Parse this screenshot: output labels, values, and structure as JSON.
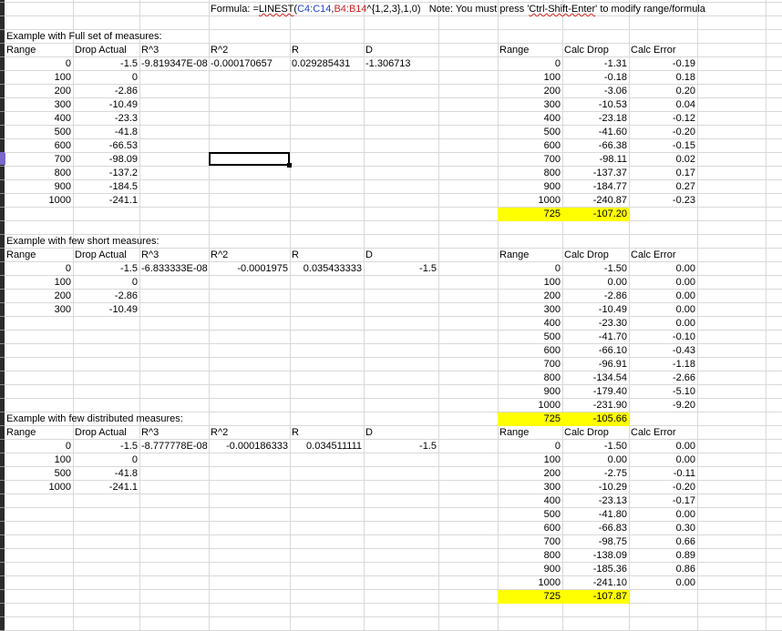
{
  "formula": {
    "prefix": "Formula: =",
    "func": "LINEST",
    "open": "(",
    "ref1": "C4:C14",
    "comma": ",",
    "ref2": "B4:B14",
    "suffix": "^{1,2,3},1,0)",
    "note_a": "Note: You must press '",
    "note_key": "Ctrl-Shift-Enter",
    "note_b": "' to modify range/formula"
  },
  "colors": {
    "highlight": "#ffff00",
    "ref1": "#1f3fd0",
    "ref2": "#d01f1f",
    "grid": "#d9d9d9"
  },
  "sections": [
    {
      "title": "Example with Full set of measures:",
      "input_headers": [
        "Range",
        "Drop Actual",
        "R^3",
        "R^2",
        "R",
        "D"
      ],
      "coeffs": [
        "-9.819347E-08",
        "-0.000170657",
        "0.029285431",
        "-1.306713"
      ],
      "input_rows": [
        [
          "0",
          "-1.5"
        ],
        [
          "100",
          "0"
        ],
        [
          "200",
          "-2.86"
        ],
        [
          "300",
          "-10.49"
        ],
        [
          "400",
          "-23.3"
        ],
        [
          "500",
          "-41.8"
        ],
        [
          "600",
          "-66.53"
        ],
        [
          "700",
          "-98.09"
        ],
        [
          "800",
          "-137.2"
        ],
        [
          "900",
          "-184.5"
        ],
        [
          "1000",
          "-241.1"
        ]
      ],
      "calc_headers": [
        "Range",
        "Calc Drop",
        "Calc Error"
      ],
      "calc_rows": [
        [
          "0",
          "-1.31",
          "-0.19"
        ],
        [
          "100",
          "-0.18",
          "0.18"
        ],
        [
          "200",
          "-3.06",
          "0.20"
        ],
        [
          "300",
          "-10.53",
          "0.04"
        ],
        [
          "400",
          "-23.18",
          "-0.12"
        ],
        [
          "500",
          "-41.60",
          "-0.20"
        ],
        [
          "600",
          "-66.38",
          "-0.15"
        ],
        [
          "700",
          "-98.11",
          "0.02"
        ],
        [
          "800",
          "-137.37",
          "0.17"
        ],
        [
          "900",
          "-184.77",
          "0.27"
        ],
        [
          "1000",
          "-240.87",
          "-0.23"
        ]
      ],
      "highlight_row": [
        "725",
        "-107.20"
      ]
    },
    {
      "title": "Example with few short measures:",
      "input_headers": [
        "Range",
        "Drop Actual",
        "R^3",
        "R^2",
        "R",
        "D"
      ],
      "coeffs": [
        "-6.833333E-08",
        "-0.0001975",
        "0.035433333",
        "-1.5"
      ],
      "input_rows": [
        [
          "0",
          "-1.5"
        ],
        [
          "100",
          "0"
        ],
        [
          "200",
          "-2.86"
        ],
        [
          "300",
          "-10.49"
        ]
      ],
      "calc_headers": [
        "Range",
        "Calc Drop",
        "Calc Error"
      ],
      "calc_rows": [
        [
          "0",
          "-1.50",
          "0.00"
        ],
        [
          "100",
          "0.00",
          "0.00"
        ],
        [
          "200",
          "-2.86",
          "0.00"
        ],
        [
          "300",
          "-10.49",
          "0.00"
        ],
        [
          "400",
          "-23.30",
          "0.00"
        ],
        [
          "500",
          "-41.70",
          "-0.10"
        ],
        [
          "600",
          "-66.10",
          "-0.43"
        ],
        [
          "700",
          "-96.91",
          "-1.18"
        ],
        [
          "800",
          "-134.54",
          "-2.66"
        ],
        [
          "900",
          "-179.40",
          "-5.10"
        ],
        [
          "1000",
          "-231.90",
          "-9.20"
        ]
      ],
      "highlight_row": [
        "725",
        "-105.66"
      ]
    },
    {
      "title": "Example with few distributed measures:",
      "input_headers": [
        "Range",
        "Drop Actual",
        "R^3",
        "R^2",
        "R",
        "D"
      ],
      "coeffs": [
        "-8.777778E-08",
        "-0.000186333",
        "0.034511111",
        "-1.5"
      ],
      "input_rows": [
        [
          "0",
          "-1.5"
        ],
        [
          "100",
          "0"
        ],
        [
          "500",
          "-41.8"
        ],
        [
          "1000",
          "-241.1"
        ]
      ],
      "calc_headers": [
        "Range",
        "Calc Drop",
        "Calc Error"
      ],
      "calc_rows": [
        [
          "0",
          "-1.50",
          "0.00"
        ],
        [
          "100",
          "0.00",
          "0.00"
        ],
        [
          "200",
          "-2.75",
          "-0.11"
        ],
        [
          "300",
          "-10.29",
          "-0.20"
        ],
        [
          "400",
          "-23.13",
          "-0.17"
        ],
        [
          "500",
          "-41.80",
          "0.00"
        ],
        [
          "600",
          "-66.83",
          "0.30"
        ],
        [
          "700",
          "-98.75",
          "0.66"
        ],
        [
          "800",
          "-138.09",
          "0.89"
        ],
        [
          "900",
          "-185.36",
          "0.86"
        ],
        [
          "1000",
          "-241.10",
          "0.00"
        ]
      ],
      "highlight_row": [
        "725",
        "-107.87"
      ]
    }
  ]
}
